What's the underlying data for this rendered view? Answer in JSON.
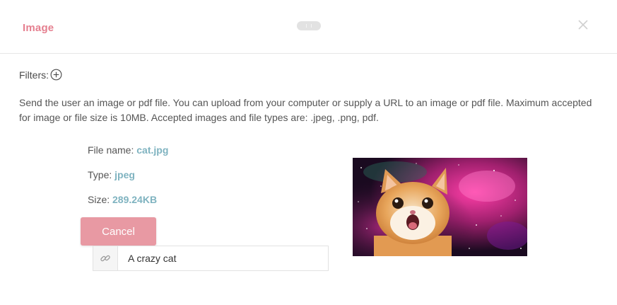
{
  "header": {
    "title": "Image",
    "close_icon": "close-icon",
    "handle_icon": "drag-handle-icon"
  },
  "filters": {
    "label": "Filters:",
    "add_icon": "plus-circle-icon"
  },
  "description": "Send the user an image or pdf file. You can upload from your computer or supply a URL to an image or pdf file. Maximum accepted for image or file size is 10MB. Accepted images and file types are: .jpeg, .png, pdf.",
  "file": {
    "name_label": "File name: ",
    "name": "cat.jpg",
    "type_label": "Type: ",
    "type": "jpeg",
    "size_label": "Size: ",
    "size": "289.24KB"
  },
  "cancel_label": "Cancel",
  "url_input": {
    "value": "A crazy cat",
    "icon": "link-icon"
  },
  "preview": {
    "icon": "cat-in-space-image"
  },
  "colors": {
    "accent": "#e57f8f",
    "button": "#e899a3",
    "value_text": "#7fb3c0"
  }
}
